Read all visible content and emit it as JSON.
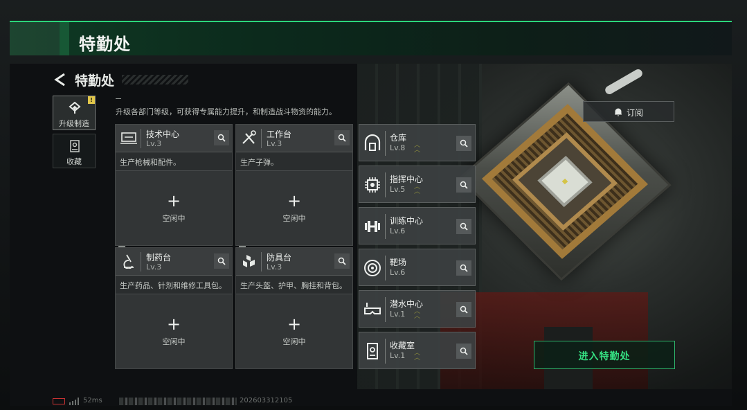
{
  "header": {
    "title": "特勤处"
  },
  "page": {
    "back_title": "特勤处",
    "description": "升级各部门等级，可获得专属能力提升，和制造战斗物资的能力。"
  },
  "side_tabs": [
    {
      "label": "升级制造",
      "icon": "upgrade-icon",
      "active": true,
      "badge": "!"
    },
    {
      "label": "收藏",
      "icon": "collection-icon",
      "active": false
    }
  ],
  "cards": [
    {
      "name": "技术中心",
      "level": "Lv.3",
      "icon": "workbench-computer-icon",
      "desc": "生产枪械和配件。",
      "slot_status": "空闲中"
    },
    {
      "name": "工作台",
      "level": "Lv.3",
      "icon": "tools-icon",
      "desc": "生产子弹。",
      "slot_status": "空闲中"
    },
    {
      "name": "制药台",
      "level": "Lv.3",
      "icon": "microscope-icon",
      "desc": "生产药品、针剂和维修工具包。",
      "slot_status": "空闲中"
    },
    {
      "name": "防具台",
      "level": "Lv.3",
      "icon": "armor-blocks-icon",
      "desc": "生产头盔、护甲、胸挂和背包。",
      "slot_status": "空闲中"
    }
  ],
  "rows": [
    {
      "name": "仓库",
      "level": "Lv.8",
      "icon": "warehouse-icon"
    },
    {
      "name": "指挥中心",
      "level": "Lv.5",
      "icon": "chip-icon"
    },
    {
      "name": "训练中心",
      "level": "Lv.6",
      "icon": "dumbbell-icon"
    },
    {
      "name": "靶场",
      "level": "Lv.6",
      "icon": "target-icon"
    },
    {
      "name": "潜水中心",
      "level": "Lv.1",
      "icon": "diving-mask-icon"
    },
    {
      "name": "收藏室",
      "level": "Lv.1",
      "icon": "display-case-icon"
    }
  ],
  "subscribe": {
    "label": "订阅"
  },
  "enter": {
    "label": "进入特勤处"
  },
  "status": {
    "ping": "52ms",
    "uid": "202603312105"
  },
  "colors": {
    "accent": "#35e082",
    "badge": "#e2c74a"
  }
}
